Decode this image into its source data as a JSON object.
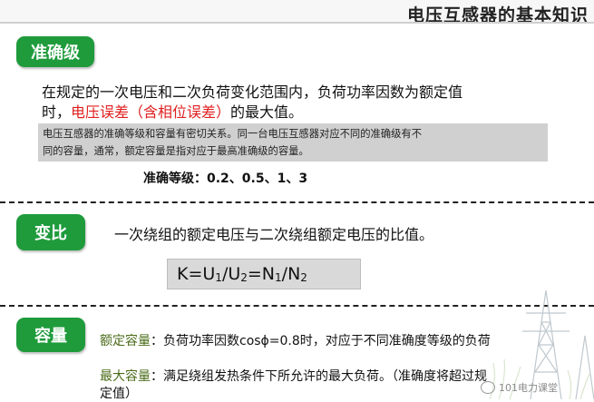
{
  "header": {
    "title": "电压互感器的基本知识"
  },
  "sec1": {
    "tag": "准确级",
    "line1": "在规定的一次电压和二次负荷变化范围内，负荷功率因数为额定值",
    "line2_prefix": "时，",
    "line2_red": "电压误差（含相位误差）",
    "line2_suffix": "的最大值。",
    "note_line1": "电压互感器的准确等级和容量有密切关系。同一台电压互感器对应不同的准确级有不",
    "note_line2": "同的容量，通常，额定容量是指对应于最高准确级的容量。",
    "classes": "准确等级：0.2、0.5、1、3"
  },
  "sec2": {
    "tag": "变比",
    "desc": "一次绕组的额定电压与二次绕组额定电压的比值。",
    "formula": {
      "k": "K=U",
      "s1": "1",
      "slash1": "/U",
      "s2": "2",
      "eq": "=N",
      "s3": "1",
      "slash2": "/N",
      "s4": "2"
    }
  },
  "sec3": {
    "tag": "容量",
    "rated_label": "额定容量",
    "rated_text": "：负荷功率因数cosϕ=0.8时，对应于不同准确度等级的负荷",
    "max_label": "最大容量",
    "max_text": "：满足绕组发热条件下所允许的最大负荷。（准确度将超过规",
    "max_text2": "定值）"
  },
  "watermark": {
    "text": "101电力课堂"
  }
}
